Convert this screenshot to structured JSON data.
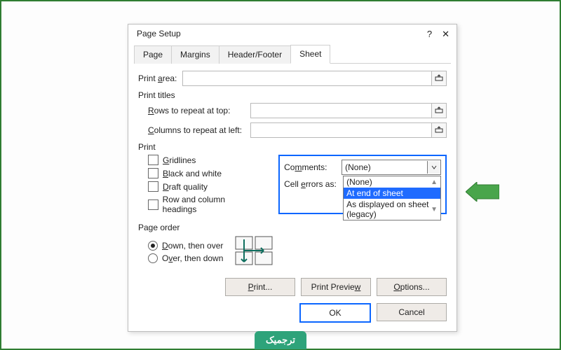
{
  "dialog": {
    "title": "Page Setup",
    "help": "?",
    "close": "✕"
  },
  "tabs": {
    "page": "Page",
    "margins": "Margins",
    "headerfooter": "Header/Footer",
    "sheet": "Sheet"
  },
  "print_area": {
    "label_pre": "Print ",
    "label_u": "a",
    "label_post": "rea:"
  },
  "print_titles": {
    "section": "Print titles",
    "rows_u": "R",
    "rows_rest": "ows to repeat at top:",
    "cols_u": "C",
    "cols_rest": "olumns to repeat at left:"
  },
  "print": {
    "section": "Print",
    "gridlines_u": "G",
    "gridlines_rest": "ridlines",
    "bw_u": "B",
    "bw_rest": "lack and white",
    "draft_u": "D",
    "draft_rest": "raft quality",
    "rowcol": "Row and column headings"
  },
  "combo": {
    "comments_pre": "Co",
    "comments_u": "m",
    "comments_post": "ments:",
    "comments_value": "(None)",
    "cellerrors_pre": "Cell ",
    "cellerrors_u": "e",
    "cellerrors_post": "rrors as:",
    "options": {
      "none": "(None)",
      "end": "At end of sheet",
      "legacy": "As displayed on sheet (legacy)"
    }
  },
  "pageorder": {
    "section": "Page order",
    "down_u": "D",
    "down_rest": "own, then over",
    "over_pre": "O",
    "over_u": "v",
    "over_post": "er, then down"
  },
  "buttons": {
    "print_u": "P",
    "print_rest": "rint...",
    "preview": "Print Previe",
    "preview_u": "w",
    "options_u": "O",
    "options_rest": "ptions...",
    "ok": "OK",
    "cancel": "Cancel"
  },
  "badge": "ترجمیک"
}
